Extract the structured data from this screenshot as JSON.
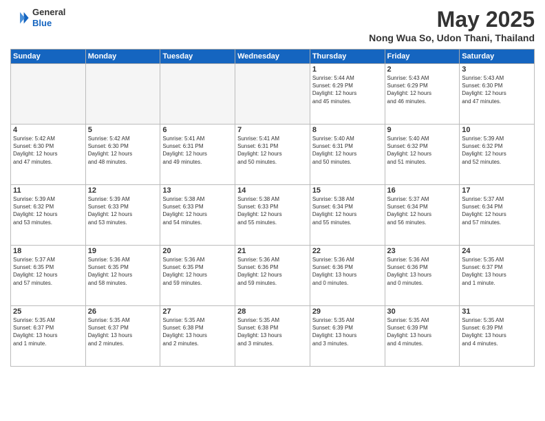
{
  "header": {
    "logo": {
      "general": "General",
      "blue": "Blue"
    },
    "title": "May 2025",
    "location": "Nong Wua So, Udon Thani, Thailand"
  },
  "weekdays": [
    "Sunday",
    "Monday",
    "Tuesday",
    "Wednesday",
    "Thursday",
    "Friday",
    "Saturday"
  ],
  "weeks": [
    [
      {
        "day": "",
        "info": ""
      },
      {
        "day": "",
        "info": ""
      },
      {
        "day": "",
        "info": ""
      },
      {
        "day": "",
        "info": ""
      },
      {
        "day": "1",
        "info": "Sunrise: 5:44 AM\nSunset: 6:29 PM\nDaylight: 12 hours\nand 45 minutes."
      },
      {
        "day": "2",
        "info": "Sunrise: 5:43 AM\nSunset: 6:29 PM\nDaylight: 12 hours\nand 46 minutes."
      },
      {
        "day": "3",
        "info": "Sunrise: 5:43 AM\nSunset: 6:30 PM\nDaylight: 12 hours\nand 47 minutes."
      }
    ],
    [
      {
        "day": "4",
        "info": "Sunrise: 5:42 AM\nSunset: 6:30 PM\nDaylight: 12 hours\nand 47 minutes."
      },
      {
        "day": "5",
        "info": "Sunrise: 5:42 AM\nSunset: 6:30 PM\nDaylight: 12 hours\nand 48 minutes."
      },
      {
        "day": "6",
        "info": "Sunrise: 5:41 AM\nSunset: 6:31 PM\nDaylight: 12 hours\nand 49 minutes."
      },
      {
        "day": "7",
        "info": "Sunrise: 5:41 AM\nSunset: 6:31 PM\nDaylight: 12 hours\nand 50 minutes."
      },
      {
        "day": "8",
        "info": "Sunrise: 5:40 AM\nSunset: 6:31 PM\nDaylight: 12 hours\nand 50 minutes."
      },
      {
        "day": "9",
        "info": "Sunrise: 5:40 AM\nSunset: 6:32 PM\nDaylight: 12 hours\nand 51 minutes."
      },
      {
        "day": "10",
        "info": "Sunrise: 5:39 AM\nSunset: 6:32 PM\nDaylight: 12 hours\nand 52 minutes."
      }
    ],
    [
      {
        "day": "11",
        "info": "Sunrise: 5:39 AM\nSunset: 6:32 PM\nDaylight: 12 hours\nand 53 minutes."
      },
      {
        "day": "12",
        "info": "Sunrise: 5:39 AM\nSunset: 6:33 PM\nDaylight: 12 hours\nand 53 minutes."
      },
      {
        "day": "13",
        "info": "Sunrise: 5:38 AM\nSunset: 6:33 PM\nDaylight: 12 hours\nand 54 minutes."
      },
      {
        "day": "14",
        "info": "Sunrise: 5:38 AM\nSunset: 6:33 PM\nDaylight: 12 hours\nand 55 minutes."
      },
      {
        "day": "15",
        "info": "Sunrise: 5:38 AM\nSunset: 6:34 PM\nDaylight: 12 hours\nand 55 minutes."
      },
      {
        "day": "16",
        "info": "Sunrise: 5:37 AM\nSunset: 6:34 PM\nDaylight: 12 hours\nand 56 minutes."
      },
      {
        "day": "17",
        "info": "Sunrise: 5:37 AM\nSunset: 6:34 PM\nDaylight: 12 hours\nand 57 minutes."
      }
    ],
    [
      {
        "day": "18",
        "info": "Sunrise: 5:37 AM\nSunset: 6:35 PM\nDaylight: 12 hours\nand 57 minutes."
      },
      {
        "day": "19",
        "info": "Sunrise: 5:36 AM\nSunset: 6:35 PM\nDaylight: 12 hours\nand 58 minutes."
      },
      {
        "day": "20",
        "info": "Sunrise: 5:36 AM\nSunset: 6:35 PM\nDaylight: 12 hours\nand 59 minutes."
      },
      {
        "day": "21",
        "info": "Sunrise: 5:36 AM\nSunset: 6:36 PM\nDaylight: 12 hours\nand 59 minutes."
      },
      {
        "day": "22",
        "info": "Sunrise: 5:36 AM\nSunset: 6:36 PM\nDaylight: 13 hours\nand 0 minutes."
      },
      {
        "day": "23",
        "info": "Sunrise: 5:36 AM\nSunset: 6:36 PM\nDaylight: 13 hours\nand 0 minutes."
      },
      {
        "day": "24",
        "info": "Sunrise: 5:35 AM\nSunset: 6:37 PM\nDaylight: 13 hours\nand 1 minute."
      }
    ],
    [
      {
        "day": "25",
        "info": "Sunrise: 5:35 AM\nSunset: 6:37 PM\nDaylight: 13 hours\nand 1 minute."
      },
      {
        "day": "26",
        "info": "Sunrise: 5:35 AM\nSunset: 6:37 PM\nDaylight: 13 hours\nand 2 minutes."
      },
      {
        "day": "27",
        "info": "Sunrise: 5:35 AM\nSunset: 6:38 PM\nDaylight: 13 hours\nand 2 minutes."
      },
      {
        "day": "28",
        "info": "Sunrise: 5:35 AM\nSunset: 6:38 PM\nDaylight: 13 hours\nand 3 minutes."
      },
      {
        "day": "29",
        "info": "Sunrise: 5:35 AM\nSunset: 6:39 PM\nDaylight: 13 hours\nand 3 minutes."
      },
      {
        "day": "30",
        "info": "Sunrise: 5:35 AM\nSunset: 6:39 PM\nDaylight: 13 hours\nand 4 minutes."
      },
      {
        "day": "31",
        "info": "Sunrise: 5:35 AM\nSunset: 6:39 PM\nDaylight: 13 hours\nand 4 minutes."
      }
    ]
  ]
}
